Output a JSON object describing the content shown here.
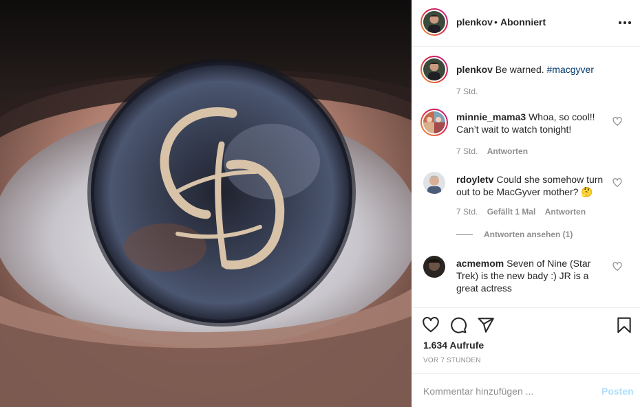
{
  "header": {
    "username": "plenkov",
    "separator": "•",
    "follow_status": "Abonniert",
    "more_icon": "more-horizontal-icon"
  },
  "caption": {
    "username": "plenkov",
    "text": "Be warned.",
    "hashtag": "#macgyver",
    "time": "7 Std."
  },
  "comments": [
    {
      "username": "minnie_mama3",
      "text": "Whoa, so cool!! Can’t wait to watch tonight!",
      "time": "7 Std.",
      "reply_label": "Antworten"
    },
    {
      "username": "rdoyletv",
      "text": "Could she somehow turn out to be MacGyver mother? 🤔",
      "time": "7 Std.",
      "likes_label": "Gefällt 1 Mal",
      "reply_label": "Antworten",
      "view_replies_label": "Antworten ansehen (1)"
    },
    {
      "username": "acmemom",
      "text": "Seven of Nine (Star Trek) is the new bady :) JR is a great actress"
    }
  ],
  "actions": {
    "icons": [
      "heart-icon",
      "comment-icon",
      "share-icon",
      "bookmark-icon"
    ],
    "views": "1.634 Aufrufe",
    "posted_ago": "VOR 7 STUNDEN"
  },
  "add_comment": {
    "placeholder": "Kommentar hinzufügen ...",
    "post_label": "Posten"
  },
  "colors": {
    "link": "#00376b",
    "post_button_disabled": "#b2dffc",
    "secondary_text": "#8e8e8e"
  }
}
